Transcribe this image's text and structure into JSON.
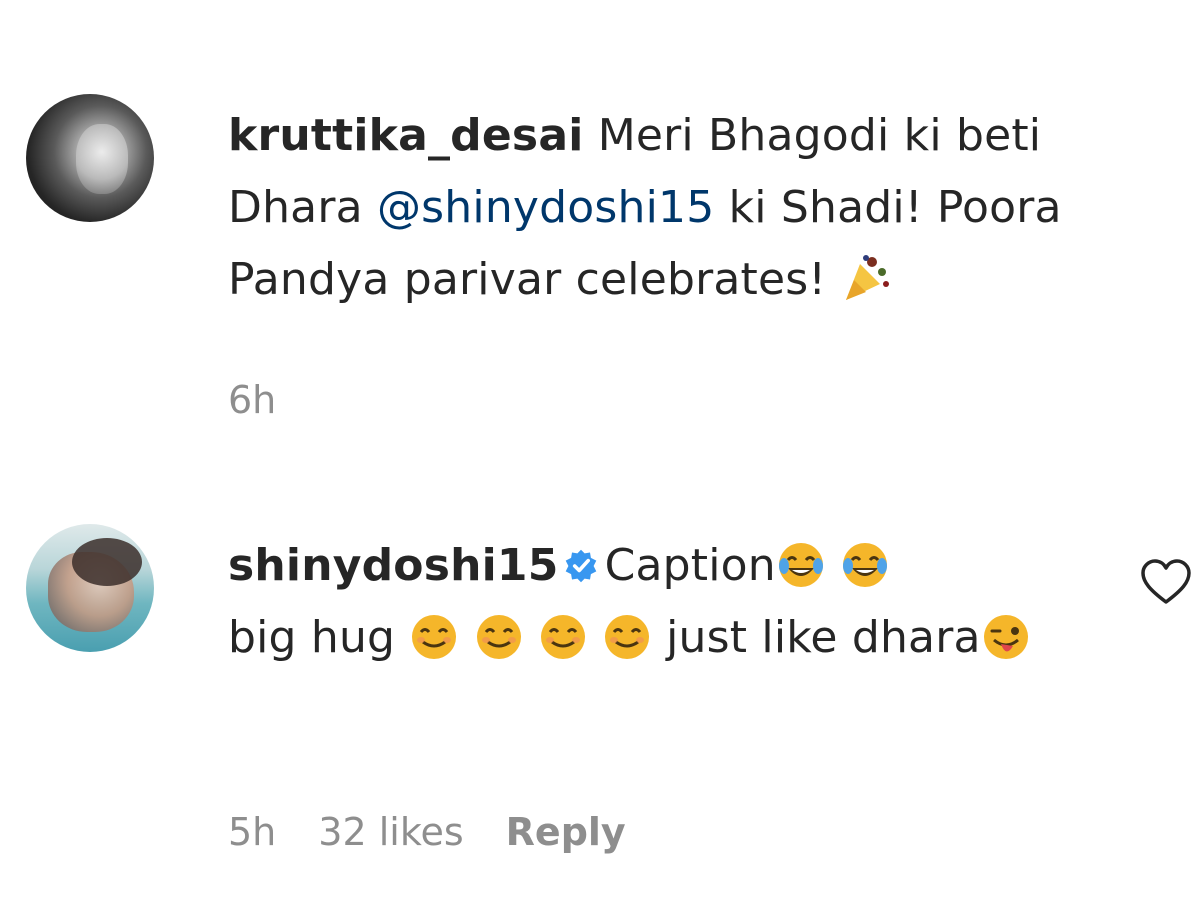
{
  "comments": [
    {
      "username": "kruttika_desai",
      "text_part1": "Meri Bhagodi ki beti Dhara ",
      "mention": "@shinydoshi15",
      "text_part2": " ki Shadi! Poora Pandya parivar celebrates! ",
      "emoji": "party-popper",
      "time": "6h"
    },
    {
      "username": "shinydoshi15",
      "verified": true,
      "caption_word": "Caption",
      "line_part1": "big hug ",
      "line_part2": " just like dhara",
      "emojis": [
        "face-with-tears-of-joy",
        "smiling-face",
        "winking-tongue-face"
      ],
      "time": "5h",
      "likes": "32 likes",
      "reply_label": "Reply"
    }
  ],
  "colors": {
    "text": "#262626",
    "secondary": "#8e8e8e",
    "mention": "#00376b",
    "verified": "#3897f0",
    "emoji_yellow": "#f5b62a"
  }
}
